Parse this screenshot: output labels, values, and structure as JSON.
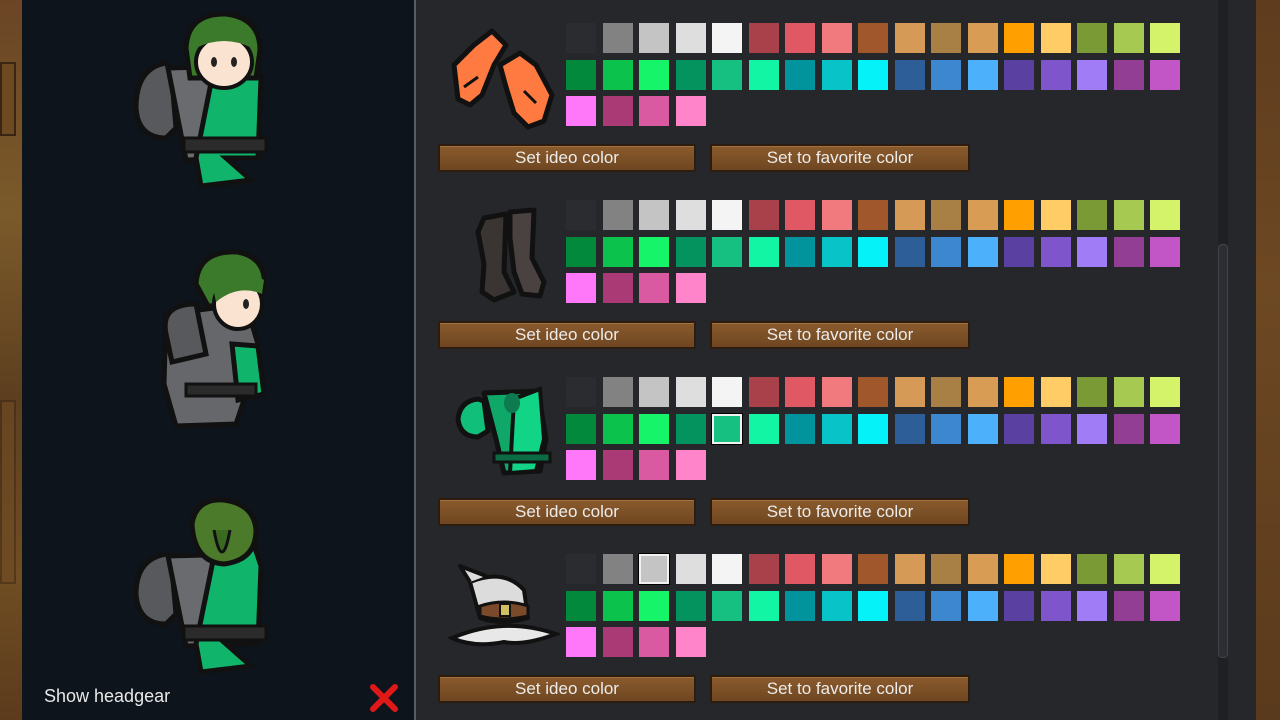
{
  "preview": {
    "show_headgear_label": "Show headgear",
    "pawns": [
      "pawn-front-view",
      "pawn-side-view",
      "pawn-back-view"
    ]
  },
  "palette": [
    "#2b2c30",
    "#828282",
    "#c4c4c4",
    "#dedede",
    "#f4f4f4",
    "#a8414a",
    "#e05863",
    "#f07a7d",
    "#a0572b",
    "#d69a57",
    "#a87f44",
    "#d89c55",
    "#ffa000",
    "#ffcc66",
    "#7a9a35",
    "#a6c951",
    "#d4f26a",
    "#03893c",
    "#0bc34c",
    "#16f56a",
    "#04935e",
    "#16c080",
    "#11f5a4",
    "#02949c",
    "#08c3c8",
    "#05f3f8",
    "#2e5e98",
    "#3c87cf",
    "#4db0fa",
    "#5940a1",
    "#7f55cc",
    "#a07cf7",
    "#923e95",
    "#c356c6",
    "#ff78f9",
    "#a93a76",
    "#da5aa1",
    "#ff84ca"
  ],
  "apparel": [
    {
      "name": "gloves",
      "icon": "gloves-icon",
      "selected": -1,
      "ideo_button": "Set ideo color",
      "fav_button": "Set to favorite color"
    },
    {
      "name": "boots",
      "icon": "boots-icon",
      "selected": -1,
      "ideo_button": "Set ideo color",
      "fav_button": "Set to favorite color"
    },
    {
      "name": "robe",
      "icon": "robe-icon",
      "selected": 21,
      "ideo_button": "Set ideo color",
      "fav_button": "Set to favorite color"
    },
    {
      "name": "wizard-hat",
      "icon": "wizard-hat-icon",
      "selected": 2,
      "ideo_button": "Set ideo color",
      "fav_button": "Set to favorite color"
    }
  ],
  "colors": {
    "button": "#7a4f26",
    "dialog_bg": "#25272b",
    "preview_bg": "#0d141c",
    "close_x": "#e01818"
  }
}
